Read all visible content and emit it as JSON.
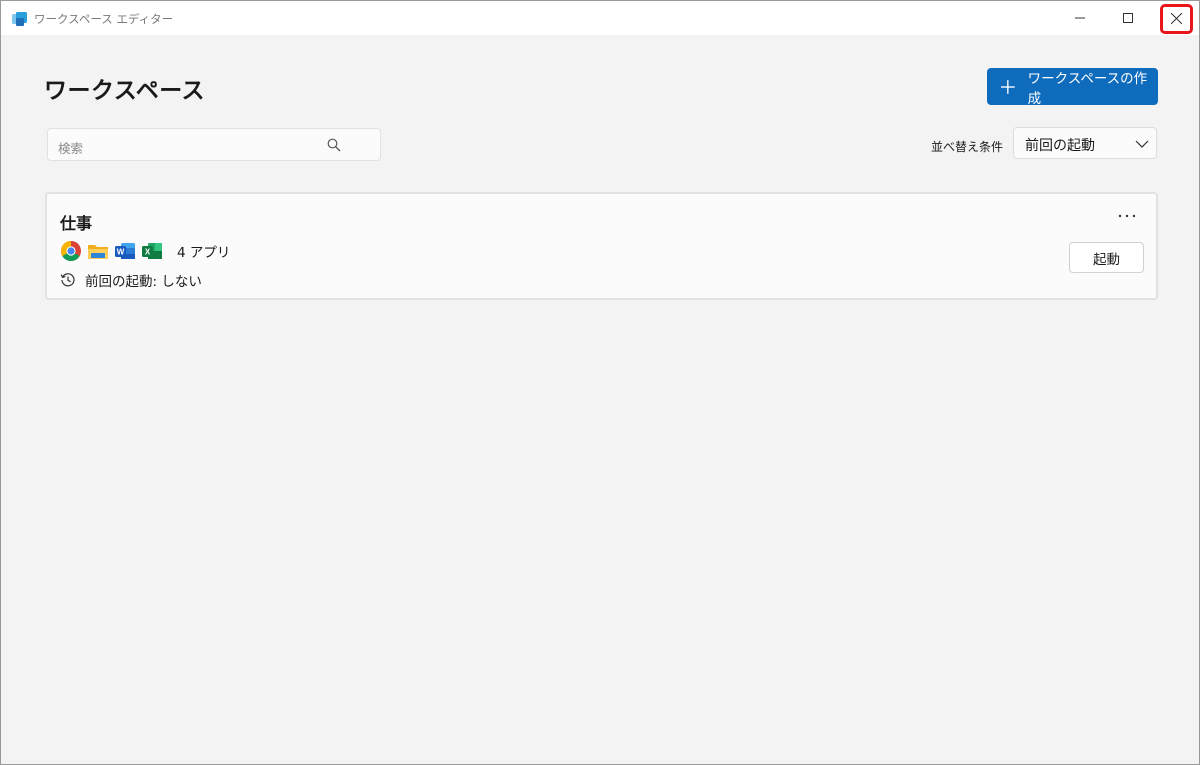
{
  "window": {
    "title": "ワークスペース エディター",
    "icon": "workspaces-app-icon"
  },
  "caption_buttons": {
    "minimize_icon": "minimize-icon",
    "maximize_icon": "maximize-icon",
    "close_icon": "close-icon",
    "close_highlight_color": "#e8151b"
  },
  "header": {
    "title": "ワークスペース",
    "create_button_label": "ワークスペースの作成",
    "create_button_color": "#0f6cbd"
  },
  "search": {
    "placeholder": "検索"
  },
  "sort": {
    "label": "並べ替え条件",
    "selected": "前回の起動"
  },
  "workspaces": [
    {
      "name": "仕事",
      "apps": [
        "chrome-icon",
        "file-explorer-icon",
        "word-icon",
        "excel-icon"
      ],
      "app_count": "4 アプリ",
      "last_launched": "前回の起動: しない",
      "launch_label": "起動",
      "more_label": "..."
    }
  ]
}
